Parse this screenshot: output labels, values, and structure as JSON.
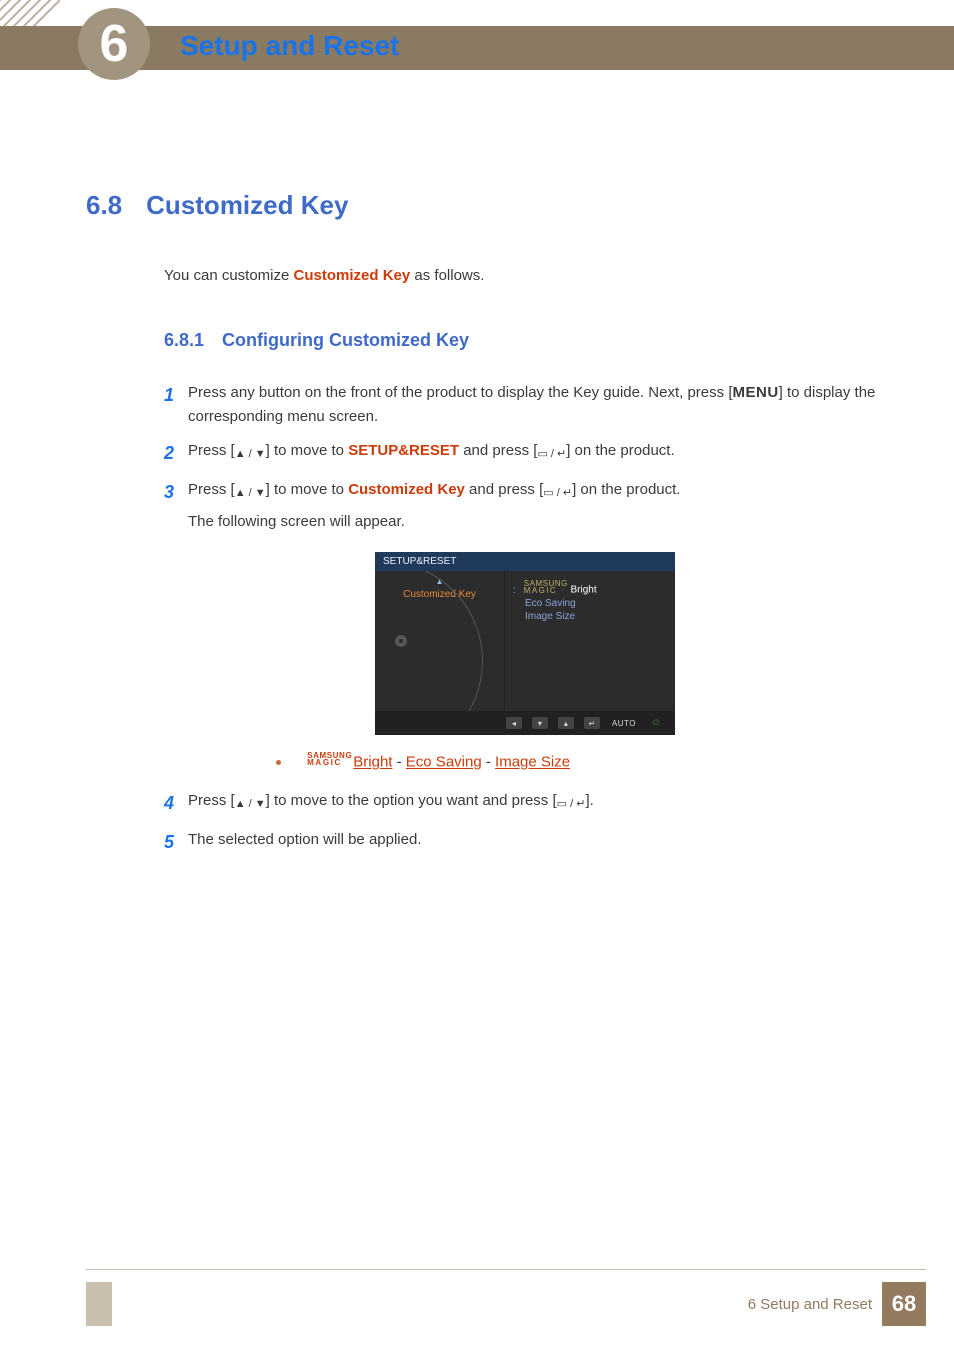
{
  "chapter": {
    "number": "6",
    "title": "Setup and Reset"
  },
  "section": {
    "number": "6.8",
    "title": "Customized Key"
  },
  "intro": {
    "prefix": "You can customize ",
    "emph": "Customized Key",
    "suffix": " as follows."
  },
  "subsection": {
    "number": "6.8.1",
    "title": "Configuring Customized Key"
  },
  "steps": {
    "1": {
      "num": "1",
      "a": "Press any button on the front of the product to display the Key guide. Next, press [",
      "menu": "MENU",
      "b": "] to display the corresponding menu screen."
    },
    "2": {
      "num": "2",
      "a": "Press [",
      "b": "] to move to ",
      "target": "SETUP&RESET",
      "c": " and press [",
      "d": "] on the product."
    },
    "3": {
      "num": "3",
      "a": "Press [",
      "b": "] to move to ",
      "target": "Customized Key",
      "c": " and press [",
      "d": "] on the product.",
      "after": "The following screen will appear."
    },
    "4": {
      "num": "4",
      "a": "Press [",
      "b": "] to move to the option you want and press [",
      "c": "]."
    },
    "5": {
      "num": "5",
      "text": "The selected option will be applied."
    }
  },
  "options": {
    "brand1": "SAMSUNG",
    "brand2": "MAGIC",
    "opt1": "Bright",
    "sep": " - ",
    "opt2": "Eco Saving",
    "opt3": "Image Size"
  },
  "osd": {
    "title": "SETUP&RESET",
    "left_label": "Customized Key",
    "colon": ":",
    "sm_brand1": "SAMSUNG",
    "sm_brand2": "MAGIC",
    "bright": "Bright",
    "eco": "Eco Saving",
    "img": "Image Size",
    "foot_auto": "AUTO"
  },
  "footer": {
    "text": "6 Setup and Reset",
    "page": "68"
  }
}
